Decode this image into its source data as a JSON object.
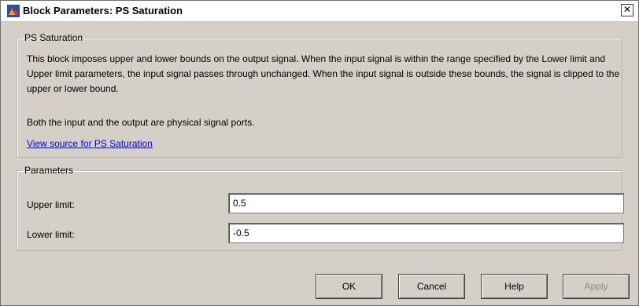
{
  "window": {
    "title": "Block Parameters: PS Saturation",
    "close_glyph": "✕"
  },
  "description_group": {
    "legend": "PS Saturation",
    "text": "This block imposes upper and lower bounds on the output signal. When the input signal is within the range specified by the Lower limit and Upper limit parameters, the input signal passes through unchanged. When the input signal is outside these bounds, the signal is clipped to the upper or lower bound.",
    "ports_text": "Both the input and the output are physical signal ports.",
    "source_link": "View source for PS Saturation"
  },
  "parameters_group": {
    "legend": "Parameters",
    "upper_limit": {
      "label": "Upper limit:",
      "value": "0.5"
    },
    "lower_limit": {
      "label": "Lower limit:",
      "value": "-0.5"
    }
  },
  "buttons": {
    "ok": "OK",
    "cancel": "Cancel",
    "help": "Help",
    "apply": "Apply"
  },
  "icons": {
    "app": "simulink-block-icon",
    "close": "close-icon"
  },
  "colors": {
    "dialog_bg": "#d4d0c8",
    "link": "#0000ee",
    "disabled_text": "#8c8a85"
  }
}
